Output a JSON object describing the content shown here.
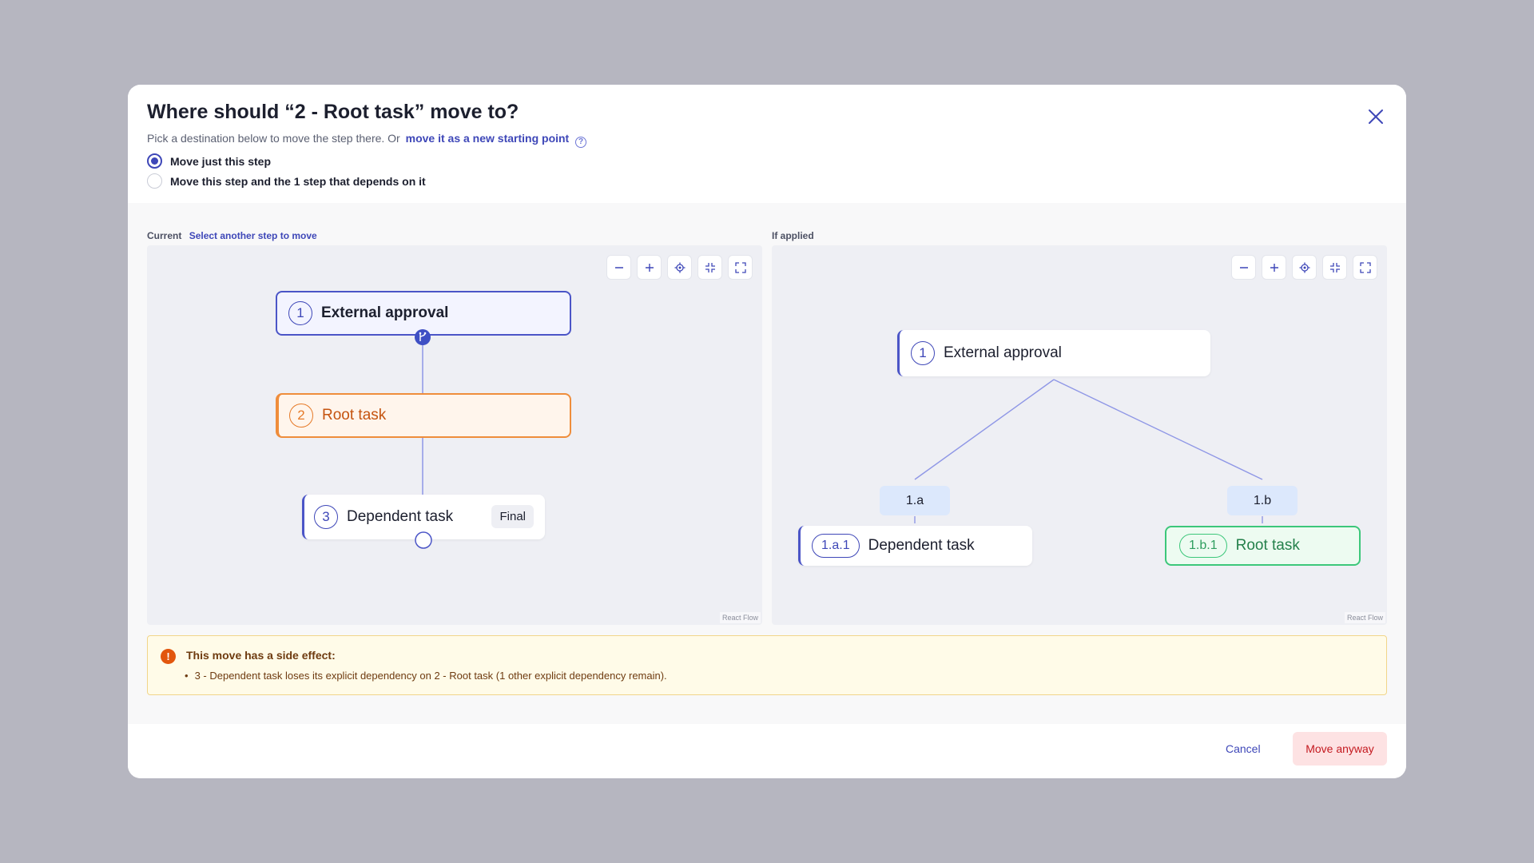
{
  "dialog": {
    "title": "Where should “2 - Root task” move to?",
    "subtitle_text": "Pick a destination below to move the step there. Or",
    "subtitle_link": "move it as a new starting point",
    "help_glyph": "?",
    "options": [
      {
        "label": "Move just this step",
        "checked": true
      },
      {
        "label": "Move this step and the 1 step that depends on it",
        "checked": false
      }
    ]
  },
  "current_panel": {
    "label": "Current",
    "link": "Select another step to move",
    "nodes": [
      {
        "number": "1",
        "title": "External approval"
      },
      {
        "number": "2",
        "title": "Root task"
      },
      {
        "number": "3",
        "title": "Dependent task",
        "badge": "Final"
      }
    ],
    "attribution": "React Flow"
  },
  "applied_panel": {
    "label": "If applied",
    "root": {
      "number": "1",
      "title": "External approval"
    },
    "branches": [
      {
        "label": "1.a",
        "node_number": "1.a.1",
        "node_title": "Dependent task"
      },
      {
        "label": "1.b",
        "node_number": "1.b.1",
        "node_title": "Root task"
      }
    ],
    "attribution": "React Flow"
  },
  "alert": {
    "icon_glyph": "!",
    "title": "This move has a side effect:",
    "items": [
      "3 - Dependent task loses its explicit dependency on 2 - Root task (1 other explicit dependency remain)."
    ]
  },
  "footer": {
    "cancel_label": "Cancel",
    "confirm_label": "Move anyway"
  },
  "colors": {
    "accent": "#3e47b8",
    "moving_step": "#ef8d3b",
    "destination": "#3cc77a",
    "danger": "#c4191f",
    "warning_bg": "#fffbe8"
  }
}
